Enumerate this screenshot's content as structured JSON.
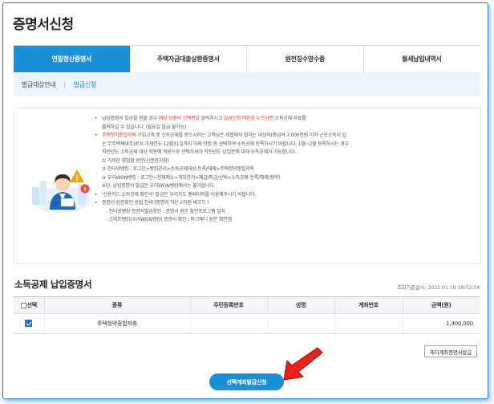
{
  "page": {
    "title": "증명서신청"
  },
  "tabs": [
    {
      "label": "연말정산증명서",
      "active": true
    },
    {
      "label": "주택자금대출상환증명서",
      "active": false
    },
    {
      "label": "원천징수영수증",
      "active": false
    },
    {
      "label": "월세납입내역서",
      "active": false
    }
  ],
  "subnav": [
    {
      "label": "발급대상안내",
      "active": false
    },
    {
      "label": "발급신청",
      "active": true
    }
  ],
  "notice": {
    "line1_a": "납입증명서 발급을 원할 경우 ",
    "line1_red1": "해당 상품의 선택란을",
    "line1_b": " 클릭하시고 ",
    "line1_red2": "발급신청 버튼을 누르시면",
    "line1_c": " 소득공제 자료를",
    "line2": "출력하실 수 있습니다. (필요일 발급 불가능)",
    "line3_red": "주택청약종합저축",
    "line3_b": " 가입고객 중 소득공제를 받으시려는 고객님은 세법에서 정하는 대상자(총급여 7,000만원 이하 근로소득이 있",
    "line4": "는 무주택세대주)로서 과세연도 12월31일까지 아래 방법 중 선택하여 소득공제 등록하시기 바랍니다. 1월~2월 등록하시는 경우",
    "line5": "직전년도 소득공제 대상 적용에 적용으로 선택하셔야 직전년도 납입분에 대해 소득공제가 가능합니다.",
    "line6": "① 가까운 영업점 방문(신분증지참)",
    "line7": "② 인터넷뱅킹 : 로그인>뱅킹관리>소득공제대상 등록/해제>주택청약종합저축",
    "line8": "③ 우리WON뱅킹 : 로그인>전체메뉴>계좌관리>예금/적금/신탁>소득공제 등록/해제(청약)",
    "line9": "※단, 납입증명서 발급은 우리WON뱅킹에서는 불가합니다.",
    "line10": "'신용카드 소득공제 확인서' 발급은 우리카드 홈페이지를 이용해주시기 바랍니다.",
    "line11": "증명서 원본확인 방법 안내 (증명서 하단 2차원 바코드 )",
    "line12": "- 인터넷뱅킹 증명서발급확인 : 증명서 원본 확인프로그램 설치",
    "line13": "- 스마트뱅킹(우리WON뱅킹) 증명서 확인 : 마크애니 원본 확인앱"
  },
  "section": {
    "title": "소득공제 납입증명서",
    "query_time": "조회기준일시: 2022.01.19 18:52:54"
  },
  "table": {
    "headers": {
      "select": "선택",
      "kind": "종류",
      "resident_no": "주민등록번호",
      "name": "성명",
      "account": "계좌번호",
      "amount": "금액(원)"
    },
    "rows": [
      {
        "checked": true,
        "kind": "주택청약종합저축",
        "resident_no": "",
        "name": "",
        "account": "",
        "amount": "1,400,000"
      }
    ]
  },
  "buttons": {
    "cancel_account_cert": "해지계좌증명서발급",
    "issue_selected": "선택계좌발급신청"
  },
  "colors": {
    "accent": "#1b8fd8",
    "highlight_red": "#e53a2c",
    "arrow_red": "#e8231f"
  }
}
